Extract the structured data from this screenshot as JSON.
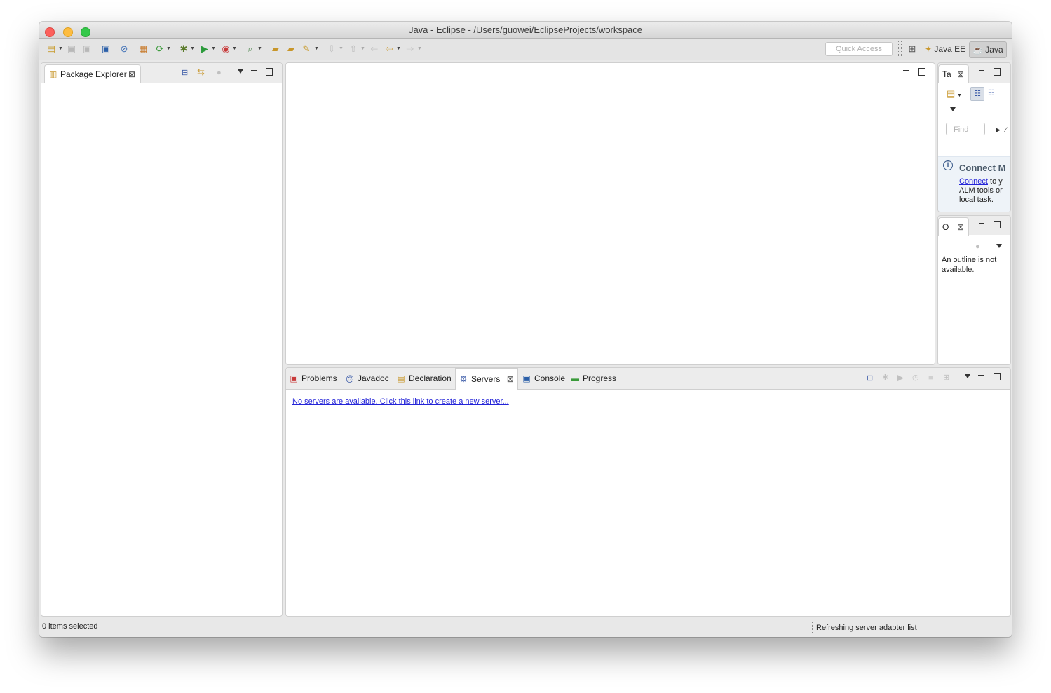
{
  "window": {
    "title": "Java - Eclipse - /Users/guowei/EclipseProjects/workspace"
  },
  "toolbar": {
    "quick_access_placeholder": "Quick Access",
    "perspectives": [
      {
        "label": "Java EE",
        "active": false
      },
      {
        "label": "Java",
        "active": true
      }
    ]
  },
  "package_explorer": {
    "tab_label": "Package Explorer"
  },
  "task_list": {
    "tab_label": "Ta",
    "find_placeholder": "Find",
    "connect_title": "Connect M",
    "connect_link": "Connect",
    "connect_text_1": " to y",
    "connect_text_2": "ALM tools or",
    "connect_text_3": "local task."
  },
  "outline": {
    "tab_label": "O",
    "message": "An outline is not available."
  },
  "bottom_panel": {
    "tabs": [
      {
        "label": "Problems",
        "icon": "problems-icon"
      },
      {
        "label": "Javadoc",
        "icon": "javadoc-icon"
      },
      {
        "label": "Declaration",
        "icon": "declaration-icon"
      },
      {
        "label": "Servers",
        "icon": "servers-icon",
        "selected": true
      },
      {
        "label": "Console",
        "icon": "console-icon"
      },
      {
        "label": "Progress",
        "icon": "progress-icon"
      }
    ],
    "servers_link": "No servers are available. Click this link to create a new server..."
  },
  "status": {
    "selection": "0 items selected",
    "progress_text": "Refreshing server adapter list"
  },
  "colors": {
    "link": "#2424d8",
    "info_title": "#4a5a6a",
    "close_red": "#fc605c",
    "min_yellow": "#fdbc40",
    "max_green": "#34c84a"
  }
}
